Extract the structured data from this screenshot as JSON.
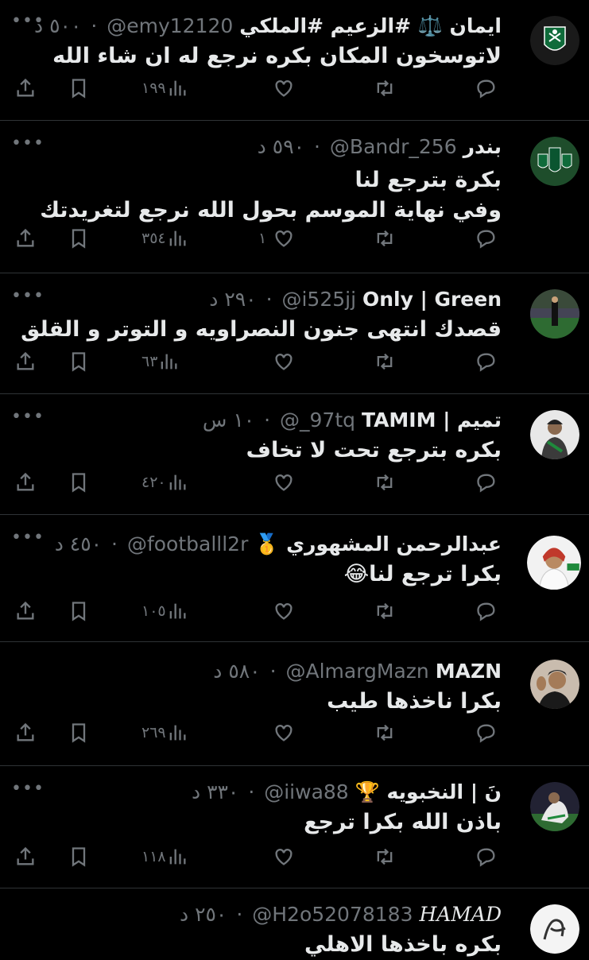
{
  "tweets": [
    {
      "name": "ايمان ⚖️ #الزعيم #الملكي",
      "handle": "@emy12120",
      "time": "٥٠٠ د",
      "text1": "لاتوسخون المكان بكره نرجع له ان شاء الله",
      "text2": "",
      "views": "١٩٩",
      "likes": "",
      "avatar": "ahli-green-logo"
    },
    {
      "name": "بندر",
      "handle": "@Bandr_256",
      "time": "٥٩٠ د",
      "text1": "بكرة بترجع لنا",
      "text2": "وفي نهاية الموسم بحول الله نرجع لتغريدتك",
      "views": "٣٥٤",
      "likes": "١",
      "avatar": "ahli-green-logos"
    },
    {
      "name": "Only | Green",
      "handle": "@i525jj",
      "time": "٢٩٠ د",
      "text1": "قصدك انتهى جنون النصراويه و التوتر و القلق",
      "text2": "",
      "views": "٦٣",
      "likes": "",
      "avatar": "stadium-photo"
    },
    {
      "name": "تميم | TAMIM",
      "handle": "@_97tq",
      "time": "١٠ س",
      "text1": "بكره بترجع تحت لا تخاف",
      "text2": "",
      "views": "٤٢٠",
      "likes": "",
      "avatar": "player-photo"
    },
    {
      "name": "عبدالرحمن المشهوري 🥇",
      "handle": "@footballl2r",
      "time": "٤٥٠ د",
      "text1": "بكرا ترجع لنا😂",
      "text2": "",
      "views": "١٠٥",
      "likes": "",
      "avatar": "man-photo"
    },
    {
      "name": "MAZN",
      "handle": "@AlmargMazn",
      "time": "٥٨٠ د",
      "text1": "بكرا ناخذها طيب",
      "text2": "",
      "views": "٢٦٩",
      "likes": "",
      "avatar": "selfie-photo"
    },
    {
      "name": "نَ | النخبويه 🏆",
      "handle": "@iiwa88",
      "time": "٣٣٠ د",
      "text1": "باذن الله بكرا ترجع",
      "text2": "",
      "views": "١١٨",
      "likes": "",
      "avatar": "celebration-photo"
    },
    {
      "name": "𝐻𝐴𝑀𝐴𝐷",
      "handle": "@H2o52078183",
      "time": "٢٥٠ د",
      "text1": "بكره باخذها الاهلي",
      "text2": "",
      "views": "",
      "likes": "",
      "avatar": "calligraphy-logo"
    }
  ],
  "more_glyph": "•••",
  "sep": "·"
}
